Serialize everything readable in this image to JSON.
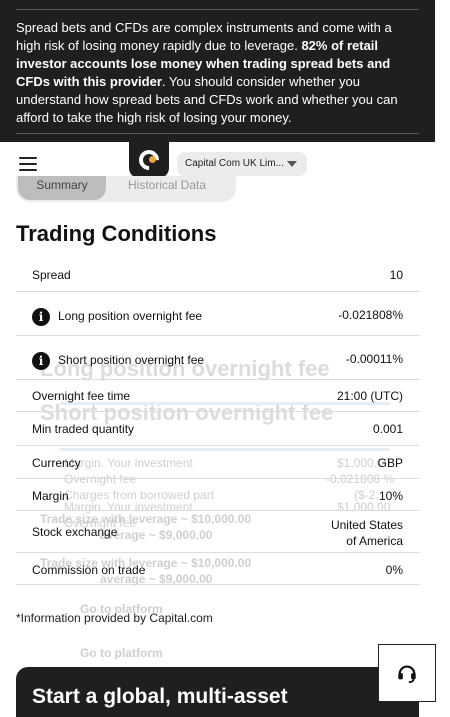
{
  "risk_warning": {
    "text_before": "Spread bets and CFDs are complex instruments and come with a high risk of losing money rapidly due to leverage. ",
    "text_bold": "82% of retail investor accounts lose money when trading spread bets and CFDs with this provider",
    "text_after": ". You should consider whether you understand how spread bets and CFDs work and whether you can afford to take the high risk of losing your money."
  },
  "header": {
    "entity_selector": "Capital Com UK Lim..."
  },
  "tabs": {
    "summary": "Summary",
    "historical": "Historical Data"
  },
  "page_title": "Trading Conditions",
  "conditions": [
    {
      "label": "Spread",
      "value": "10"
    },
    {
      "label": "Long position overnight fee",
      "value": "-0.021808%"
    },
    {
      "label": "Short position overnight fee",
      "value": "-0.00011%"
    },
    {
      "label": "Overnight fee time",
      "value": "21:00 (UTC)"
    },
    {
      "label": "Min traded quantity",
      "value": "0.001"
    },
    {
      "label": "Currency",
      "value": "GBP"
    },
    {
      "label": "Margin",
      "value": "10%"
    },
    {
      "label": "Stock exchange",
      "value_line1": "United States",
      "value_line2": "of America"
    },
    {
      "label": "Commission on trade",
      "value": "0%"
    }
  ],
  "footnote": "*Information provided by Capital.com",
  "promo_heading": "Start a global, multi-asset",
  "background_ghost": {
    "long_fee_heading": "Long position overnight fee",
    "short_fee_heading": "Short position overnight fee",
    "margin_investment_1": "Margin. Your investment",
    "amount_1": "$1,000.00",
    "overnight_fee": "Overnight fee",
    "fee_percent": "-0.021808 %",
    "charges_borrowed": "Charges from borrowed part",
    "charges_amount": "($-2.",
    "margin_investment_2": "Margin. Your investment",
    "amount_2": "$1,000.00",
    "overnight_fee_2": "Overnight fee",
    "trade_size_1": "Trade size with leverage ~ $10,000.00",
    "leverage_1": "average ~ $9,000.00",
    "trade_size_2": "Trade size with leverage ~ $10,000.00",
    "leverage_2": "average ~ $9,000.00",
    "go_platform_1": "Go to platform",
    "go_platform_2": "Go to platform"
  },
  "colors": {
    "banner_bg": "#1f1f1f",
    "logo_accent": "#f2a43a",
    "divider": "#dcdcdc"
  }
}
